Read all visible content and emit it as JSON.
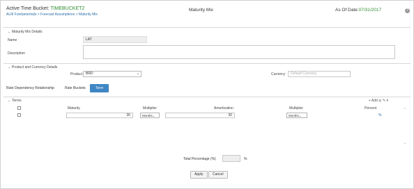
{
  "header": {
    "title_prefix": "Active Time Bucket: ",
    "bucket_name": "TIMEBUCKET2",
    "breadcrumb": "ALM Fundamentals > Forecast Assumptions > Maturity Mix",
    "center_title": "Maturity Mix",
    "as_of_label": "As Of Date:",
    "as_of_date": "07/31/2017",
    "help_icon": "?"
  },
  "maturity_mix_details": {
    "heading": "Maturity Mix Details",
    "name_label": "Name",
    "name_value": "LAT",
    "description_label": "Description",
    "description_value": ""
  },
  "product_currency": {
    "heading": "Product and Currency Details",
    "product_label": "Product",
    "product_value": "BRD",
    "currency_label": "Currency",
    "currency_placeholder": "Default Currency"
  },
  "tabs": {
    "rate_dependency": "Rate Dependency Relationship",
    "rate_buckets": "Rate Buckets",
    "button_label": "Term"
  },
  "grid": {
    "section_label": "Terms",
    "toolbar": "+ Add   ◎ ✎ ▾",
    "columns": [
      "Maturity",
      "Multiplier",
      "Amortization",
      "Multiplier",
      "Percent"
    ],
    "rows": [
      {
        "maturity": "30",
        "maturity_unit": "Months",
        "amortization": "30",
        "amort_unit": "Months",
        "percent": "%"
      }
    ]
  },
  "footer": {
    "total_label": "Total Percentage (%)",
    "total_value": "",
    "total_pct_suffix": "%",
    "apply_label": "Apply",
    "cancel_label": "Cancel"
  }
}
